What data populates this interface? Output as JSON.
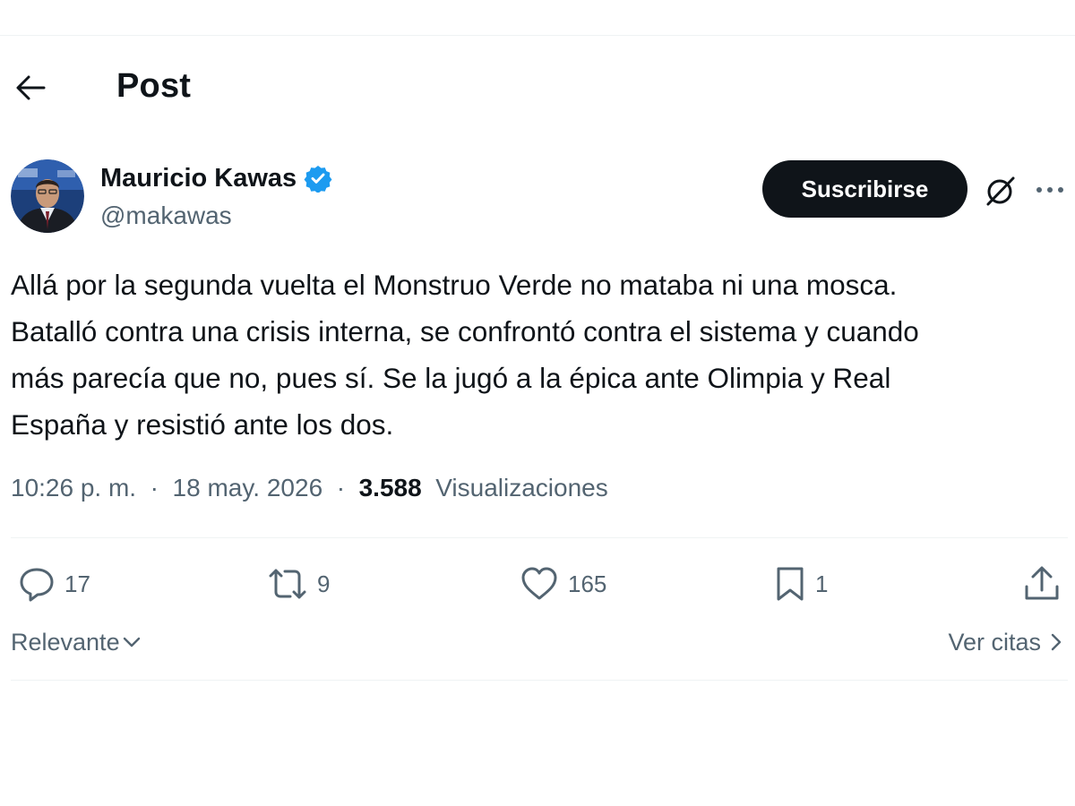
{
  "header": {
    "back_icon": "arrow-left-icon",
    "title": "Post"
  },
  "author": {
    "name": "Mauricio Kawas",
    "handle": "@makawas",
    "verified_icon": "verified-badge-icon",
    "verified_color": "#1d9bf0"
  },
  "toolbar": {
    "subscribe_label": "Suscribirse",
    "grok_icon": "grok-icon",
    "more_icon": "more-dots-icon"
  },
  "post": {
    "lines": [
      "Allá por la segunda vuelta el Monstruo Verde no mataba ni una mosca.",
      "Batalló contra una crisis interna, se confrontó contra el sistema y cuando",
      "más parecía que no, pues sí. Se la jugó a la épica ante Olimpia y Real",
      "España y resistió ante los dos."
    ]
  },
  "meta": {
    "time": "10:26 p. m.",
    "separator": "·",
    "date": "18 may. 2026",
    "views_count": "3.588",
    "views_label": "Visualizaciones"
  },
  "actions": {
    "replies": "17",
    "reposts": "9",
    "likes": "165",
    "bookmarks": "1"
  },
  "footer": {
    "sort_label": "Relevante",
    "quotes_label": "Ver citas"
  },
  "colors": {
    "text_primary": "#0f1419",
    "text_secondary": "#536471",
    "divider": "#eff3f4",
    "button_bg": "#0f1419"
  }
}
